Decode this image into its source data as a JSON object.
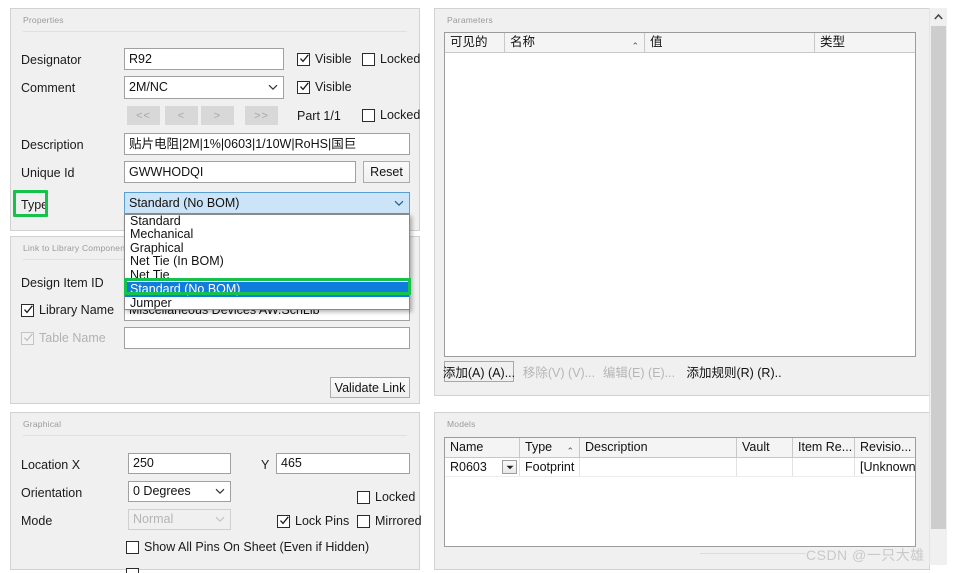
{
  "properties_panel": {
    "title": "Properties",
    "designator": {
      "label": "Designator",
      "value": "R92",
      "visible_label": "Visible",
      "locked_label": "Locked"
    },
    "comment": {
      "label": "Comment",
      "value": "2M/NC",
      "visible_label": "Visible"
    },
    "part_nav": {
      "first": "<<",
      "prev": "<",
      "next": ">",
      "last": ">>",
      "part_text": "Part 1/1",
      "locked_label": "Locked"
    },
    "description": {
      "label": "Description",
      "value": "贴片电阻|2M|1%|0603|1/10W|RoHS|国巨"
    },
    "unique_id": {
      "label": "Unique Id",
      "value": "GWWHODQI",
      "reset_label": "Reset"
    },
    "type": {
      "label": "Type",
      "value": "Standard (No BOM)"
    }
  },
  "type_dropdown": {
    "options": [
      "Standard",
      "Mechanical",
      "Graphical",
      "Net Tie (In BOM)",
      "Net Tie",
      "Standard (No BOM)",
      "Jumper"
    ],
    "selected": "Standard (No BOM)",
    "selected_index": 5
  },
  "link_panel": {
    "title": "Link to Library Component",
    "design_item_id": {
      "label": "Design Item ID",
      "value": ""
    },
    "library_name": {
      "label": "Library Name",
      "value": "Miscellaneous Devices AW.SchLib",
      "checked": true
    },
    "table_name": {
      "label": "Table Name",
      "value": "",
      "checked": true,
      "disabled": true
    },
    "validate_link": "Validate Link"
  },
  "graphical_panel": {
    "title": "Graphical",
    "location": {
      "label": "Location  X",
      "x_value": "250",
      "y_label": "Y",
      "y_value": "465"
    },
    "orientation": {
      "label": "Orientation",
      "value": "0 Degrees"
    },
    "mode": {
      "label": "Mode",
      "value": "Normal"
    },
    "locked_label": "Locked",
    "lock_pins_label": "Lock Pins",
    "mirrored_label": "Mirrored",
    "show_all_pins_label": "Show All Pins On Sheet (Even if Hidden)"
  },
  "parameters_panel": {
    "title": "Parameters",
    "columns": [
      "可见的",
      "名称",
      "值",
      "类型"
    ],
    "sort_column_index": 1,
    "sort_mark": "⌃",
    "rows": [],
    "buttons": [
      {
        "label": "添加(A) (A)...",
        "enabled": true
      },
      {
        "label": "移除(V) (V)...",
        "enabled": false
      },
      {
        "label": "编辑(E) (E)...",
        "enabled": false
      },
      {
        "label": "添加规则(R) (R)..",
        "enabled": true
      }
    ]
  },
  "models_panel": {
    "title": "Models",
    "columns": [
      "Name",
      "Type",
      "Description",
      "Vault",
      "Item Re...",
      "Revisio..."
    ],
    "sort_column_index": 1,
    "sort_mark": "⌃",
    "rows": [
      {
        "name": "R0603",
        "type": "Footprint",
        "description": "",
        "vault": "",
        "item_rev": "",
        "revision": "[Unknown"
      }
    ]
  },
  "scrollbar": {
    "up_arrow": "⌃"
  },
  "watermark": {
    "text": "CSDN @一只大雄"
  },
  "colors": {
    "panel_bg": "#f0f0f0",
    "field_bg": "#ffffff",
    "accent_select": "#0f7ddb",
    "annotation_green": "#16c24a",
    "combo_open": "#cce4f7"
  }
}
